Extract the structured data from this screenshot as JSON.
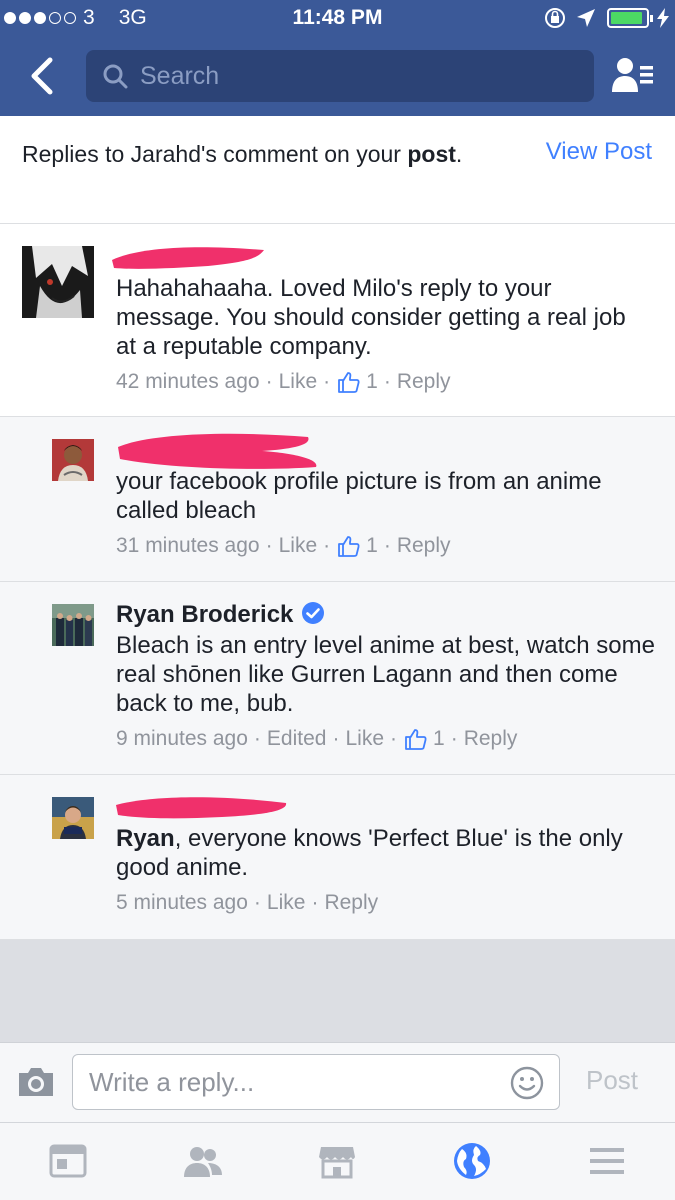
{
  "status_bar": {
    "signal_dots_filled": 3,
    "signal_dots_total": 5,
    "carrier": "3",
    "network": "3G",
    "time": "11:48 PM",
    "battery_level_fraction": 0.9
  },
  "nav": {
    "search_placeholder": "Search"
  },
  "header": {
    "text_prefix": "Replies to Jarahd's comment on your ",
    "text_bold": "post",
    "text_suffix": ".",
    "view_post": "View Post"
  },
  "comments": [
    {
      "name": "",
      "text": "Hahahahaaha. Loved Milo's reply to your message. You should consider getting a real job at a reputable company.",
      "time": "42 minutes ago",
      "like": "Like",
      "likes_count": "1",
      "reply": "Reply"
    },
    {
      "name": "",
      "text": "your facebook profile picture is from an anime called bleach",
      "time": "31 minutes ago",
      "like": "Like",
      "likes_count": "1",
      "reply": "Reply"
    },
    {
      "name": "Ryan Broderick",
      "text": "Bleach is an entry level anime at best, watch some real shōnen like Gurren Lagann and then come back to me, bub.",
      "time": "9 minutes ago",
      "edited": "Edited",
      "like": "Like",
      "likes_count": "1",
      "reply": "Reply"
    },
    {
      "name": "",
      "mention": "Ryan",
      "text": ", everyone knows 'Perfect Blue' is the only good anime.",
      "time": "5 minutes ago",
      "like": "Like",
      "reply": "Reply"
    }
  ],
  "composer": {
    "placeholder": "Write a reply...",
    "post_label": "Post"
  },
  "colors": {
    "brand": "#3b5998",
    "link": "#4080ff",
    "redaction": "#f0306b",
    "meta_gray": "#90949c",
    "active_tab": "#4080ff"
  },
  "icons": [
    "back-icon",
    "search-icon",
    "friend-requests-icon",
    "like-thumb-icon",
    "verified-badge-icon",
    "camera-icon",
    "emoji-icon",
    "news-feed-icon",
    "friends-icon",
    "marketplace-icon",
    "globe-icon",
    "menu-icon"
  ]
}
